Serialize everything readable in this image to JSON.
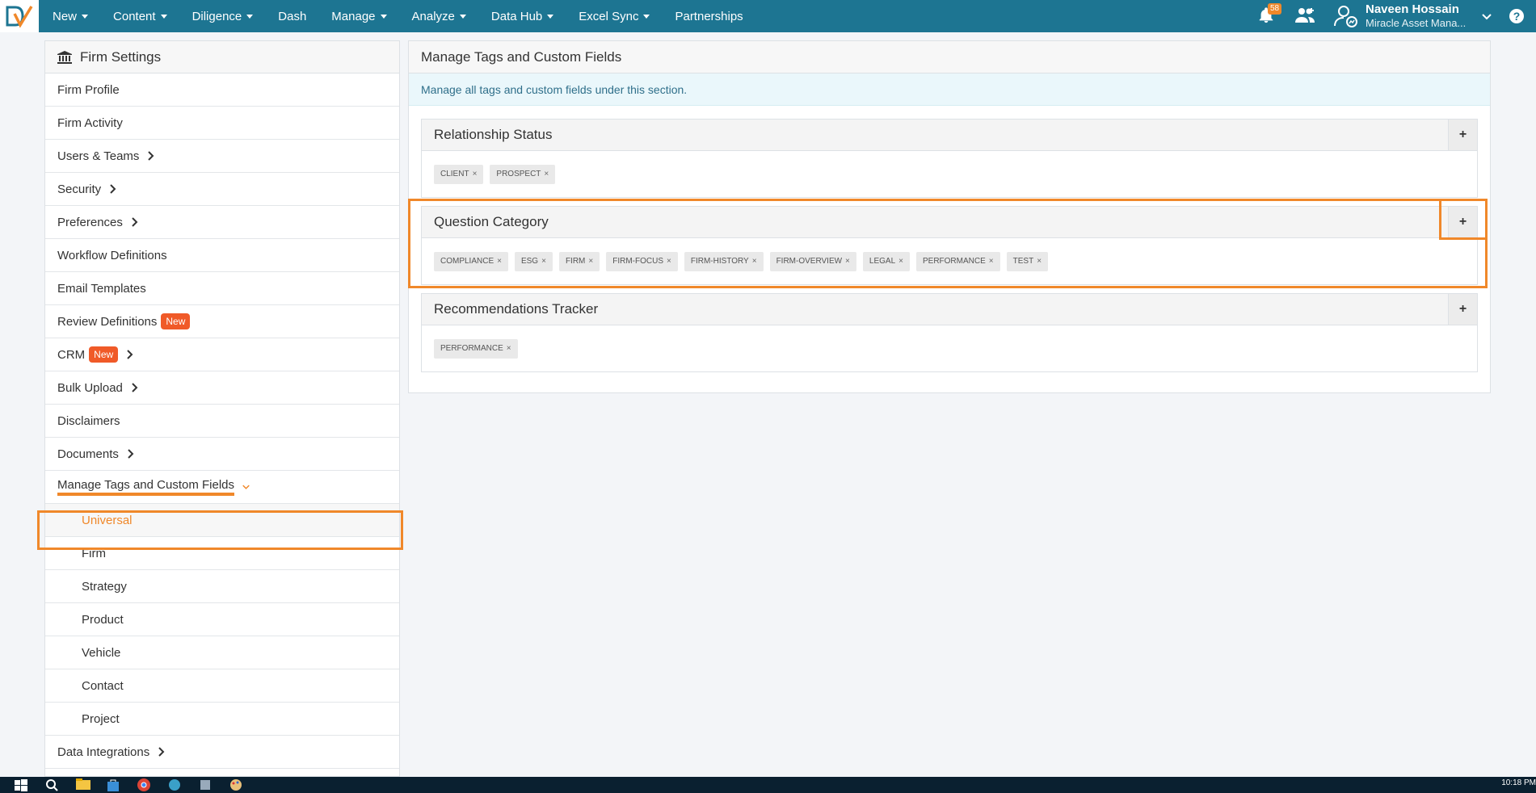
{
  "nav": {
    "items": [
      {
        "label": "New",
        "dropdown": true
      },
      {
        "label": "Content",
        "dropdown": true
      },
      {
        "label": "Diligence",
        "dropdown": true
      },
      {
        "label": "Dash",
        "dropdown": false
      },
      {
        "label": "Manage",
        "dropdown": true
      },
      {
        "label": "Analyze",
        "dropdown": true
      },
      {
        "label": "Data Hub",
        "dropdown": true
      },
      {
        "label": "Excel Sync",
        "dropdown": true
      },
      {
        "label": "Partnerships",
        "dropdown": false
      }
    ],
    "notifications_count": "58",
    "user_name": "Naveen Hossain",
    "user_org": "Miracle Asset Mana...",
    "help_label": "?"
  },
  "sidebar": {
    "title": "Firm Settings",
    "items": [
      {
        "label": "Firm Profile"
      },
      {
        "label": "Firm Activity"
      },
      {
        "label": "Users & Teams",
        "chevron": true
      },
      {
        "label": "Security",
        "chevron": true
      },
      {
        "label": "Preferences",
        "chevron": true
      },
      {
        "label": "Workflow Definitions"
      },
      {
        "label": "Email Templates"
      },
      {
        "label": "Review Definitions",
        "badge": "New"
      },
      {
        "label": "CRM",
        "badge": "New",
        "chevron": true
      },
      {
        "label": "Bulk Upload",
        "chevron": true
      },
      {
        "label": "Disclaimers"
      },
      {
        "label": "Documents",
        "chevron": true
      },
      {
        "label": "Manage Tags and Custom Fields",
        "expanded": true
      },
      {
        "label": "Universal",
        "sub": true,
        "active": true
      },
      {
        "label": "Firm",
        "sub": true
      },
      {
        "label": "Strategy",
        "sub": true
      },
      {
        "label": "Product",
        "sub": true
      },
      {
        "label": "Vehicle",
        "sub": true
      },
      {
        "label": "Contact",
        "sub": true
      },
      {
        "label": "Project",
        "sub": true
      },
      {
        "label": "Data Integrations",
        "chevron": true
      }
    ]
  },
  "main": {
    "title": "Manage Tags and Custom Fields",
    "info": "Manage all tags and custom fields under this section.",
    "panels": [
      {
        "title": "Relationship Status",
        "tags": [
          "CLIENT",
          "PROSPECT"
        ]
      },
      {
        "title": "Question Category",
        "tags": [
          "COMPLIANCE",
          "ESG",
          "FIRM",
          "FIRM-FOCUS",
          "FIRM-HISTORY",
          "FIRM-OVERVIEW",
          "LEGAL",
          "PERFORMANCE",
          "TEST"
        ]
      },
      {
        "title": "Recommendations Tracker",
        "tags": [
          "PERFORMANCE"
        ]
      }
    ],
    "add_label": "+",
    "remove_label": "×"
  },
  "taskbar": {
    "time": "10:18 PM"
  },
  "colors": {
    "nav": "#1d7592",
    "accent": "#f0882a",
    "badge": "#f05a28"
  }
}
